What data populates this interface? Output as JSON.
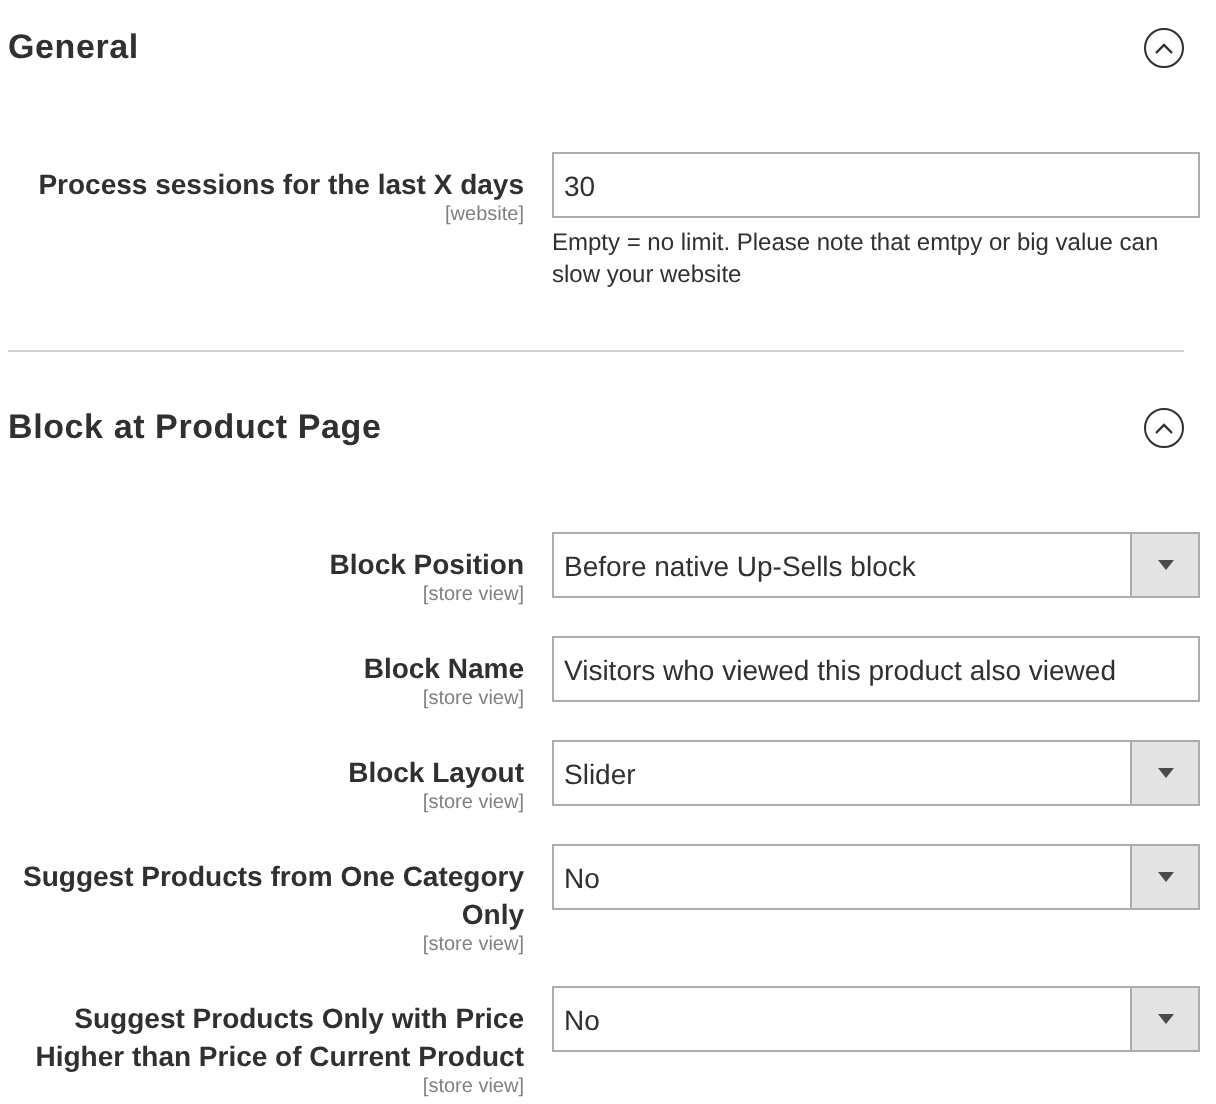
{
  "sections": [
    {
      "title": "General",
      "expanded": true,
      "fields": [
        {
          "kind": "text",
          "label": "Process sessions for the last X days",
          "scope": "[website]",
          "value": "30",
          "note": "Empty = no limit. Please note that emtpy or big value can slow your website"
        }
      ]
    },
    {
      "title": "Block at Product Page",
      "expanded": true,
      "fields": [
        {
          "kind": "select",
          "label": "Block Position",
          "scope": "[store view]",
          "value": "Before native Up-Sells block"
        },
        {
          "kind": "text",
          "label": "Block Name",
          "scope": "[store view]",
          "value": "Visitors who viewed this product also viewed"
        },
        {
          "kind": "select",
          "label": "Block Layout",
          "scope": "[store view]",
          "value": "Slider"
        },
        {
          "kind": "select",
          "label": "Suggest Products from One Category Only",
          "scope": "[store view]",
          "value": "No"
        },
        {
          "kind": "select",
          "label": "Suggest Products Only with Price Higher than Price of Current Product",
          "scope": "[store view]",
          "value": "No"
        }
      ]
    }
  ]
}
